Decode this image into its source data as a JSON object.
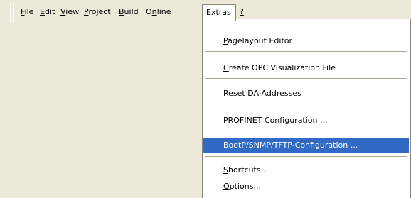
{
  "menubar": {
    "items": [
      {
        "label_pre": "",
        "mnemonic": "F",
        "label_post": "ile"
      },
      {
        "label_pre": "",
        "mnemonic": "E",
        "label_post": "dit"
      },
      {
        "label_pre": "",
        "mnemonic": "V",
        "label_post": "iew"
      },
      {
        "label_pre": "",
        "mnemonic": "P",
        "label_post": "roject"
      },
      {
        "label_pre": "",
        "mnemonic": "B",
        "label_post": "uild"
      },
      {
        "label_pre": "O",
        "mnemonic": "n",
        "label_post": "line"
      },
      {
        "label_pre": "E",
        "mnemonic": "x",
        "label_post": "tras"
      },
      {
        "label_pre": "",
        "mnemonic": "?",
        "label_post": ""
      }
    ]
  },
  "extras_menu": {
    "items": [
      {
        "label_pre": "",
        "mnemonic": "P",
        "label_post": "agelayout Editor"
      },
      {
        "label_pre": "",
        "mnemonic": "C",
        "label_post": "reate OPC Visualization File"
      },
      {
        "label_pre": "",
        "mnemonic": "R",
        "label_post": "eset DA-Addresses"
      },
      {
        "label_pre": "PROFINET Configuration ...",
        "mnemonic": "",
        "label_post": ""
      },
      {
        "label_pre": "BootP/SNMP/TFTP-Configuration ...",
        "mnemonic": "",
        "label_post": ""
      },
      {
        "label_pre": "",
        "mnemonic": "S",
        "label_post": "hortcuts..."
      },
      {
        "label_pre": "",
        "mnemonic": "O",
        "label_post": "ptions..."
      }
    ],
    "highlighted_item": "BootP/SNMP/TFTP-Configuration ..."
  },
  "colors": {
    "face": "#ece9d8",
    "highlight": "#316ac5",
    "menu_bg": "#ffffff"
  }
}
